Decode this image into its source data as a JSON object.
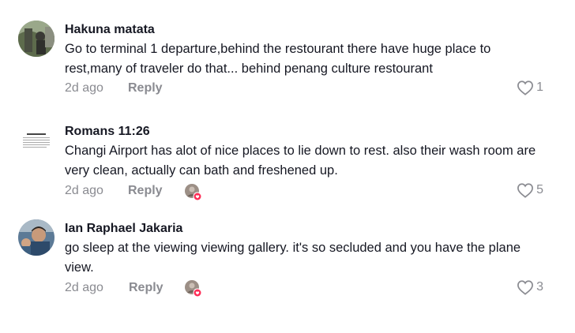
{
  "comments": [
    {
      "username": "Hakuna matata",
      "text": "Go to terminal 1 departure,behind the restourant there have huge place to rest,many of traveler do that... behind penang culture restourant",
      "time": "2d ago",
      "reply_label": "Reply",
      "likes": "1",
      "creator_liked": false
    },
    {
      "username": "Romans 11:26",
      "text": "Changi Airport has alot of nice places to lie down to rest. also their wash room are very clean, actually can bath and freshened up.",
      "time": "2d ago",
      "reply_label": "Reply",
      "likes": "5",
      "creator_liked": true,
      "avatar_title": "Romans 11:26"
    },
    {
      "username": "Ian Raphael Jakaria",
      "text": "go sleep at the viewing viewing gallery. it's so secluded and you have the plane view.",
      "time": "2d ago",
      "reply_label": "Reply",
      "likes": "3",
      "creator_liked": true
    }
  ],
  "icons": {
    "like": "heart-outline-icon",
    "creator_like": "creator-liked-badge-icon"
  },
  "colors": {
    "text": "#161823",
    "muted": "#8a8b91",
    "heart_badge": "#fe2c55"
  }
}
